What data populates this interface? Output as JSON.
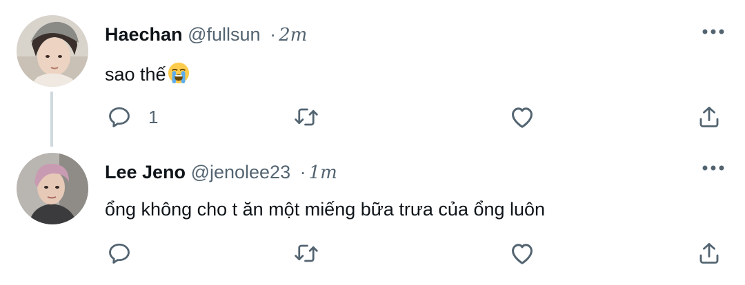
{
  "tweets": [
    {
      "name": "Haechan",
      "handle": "@fullsun",
      "separator": "·",
      "time": "2m",
      "text": "sao thế",
      "emoji_icon": "loudly-crying-face-icon",
      "reply_count": "1",
      "retweet_count": "",
      "like_count": ""
    },
    {
      "name": "Lee Jeno",
      "handle": "@jenolee23",
      "separator": "·",
      "time": "1m",
      "text": "ổng không cho t ăn một miếng bữa trưa của ổng luôn",
      "reply_count": "",
      "retweet_count": "",
      "like_count": ""
    }
  ],
  "icons": {
    "reply": "reply-icon",
    "retweet": "retweet-icon",
    "like": "heart-icon",
    "share": "share-icon",
    "more": "more-icon"
  },
  "colors": {
    "text": "#0f1419",
    "secondary": "#536471",
    "thread_line": "#cfd9de"
  }
}
